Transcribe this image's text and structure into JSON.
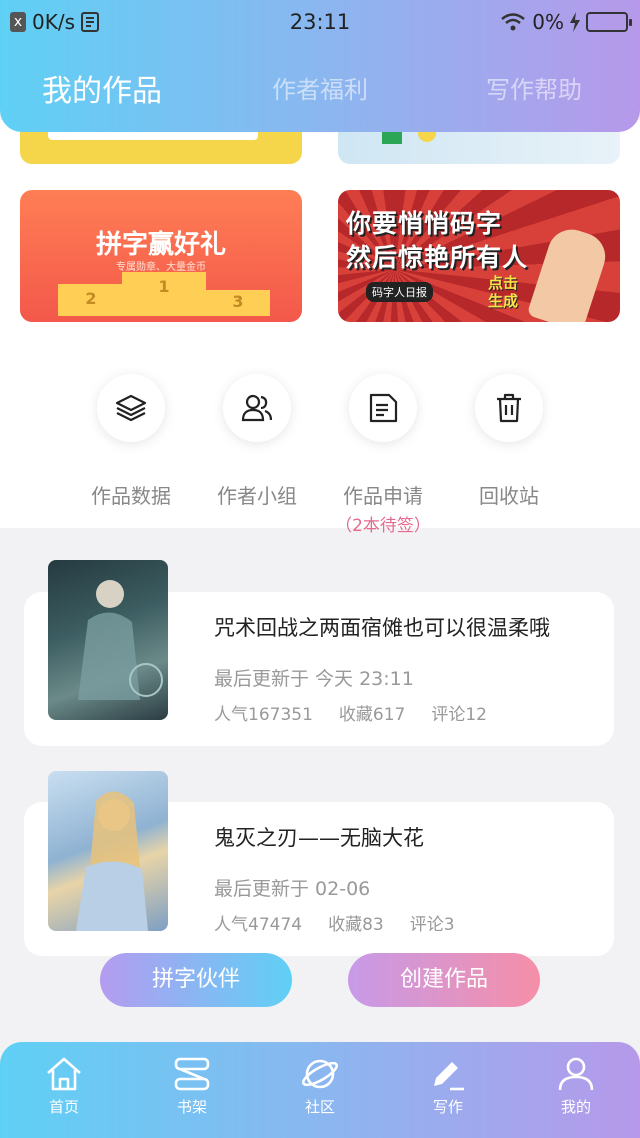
{
  "status_bar": {
    "speed": "0K/s",
    "time": "23:11",
    "battery": "0%"
  },
  "header": {
    "tabs": [
      {
        "label": "我的作品",
        "active": true
      },
      {
        "label": "作者福利",
        "active": false
      },
      {
        "label": "写作帮助",
        "active": false
      }
    ]
  },
  "banners": {
    "left_title": "拼字赢好礼",
    "left_sub": "专属勋章、大量金币",
    "podium": [
      "2",
      "1",
      "3"
    ],
    "right_line1": "你要悄悄码字",
    "right_line2": "然后惊艳所有人",
    "right_tag": "码字人日报",
    "right_cta1": "点击",
    "right_cta2": "生成"
  },
  "actions": [
    {
      "label": "作品数据",
      "icon": "layers-icon"
    },
    {
      "label": "作者小组",
      "icon": "group-icon"
    },
    {
      "label": "作品申请",
      "icon": "document-icon",
      "note": "（2本待签）"
    },
    {
      "label": "回收站",
      "icon": "trash-icon"
    }
  ],
  "works": [
    {
      "title": "咒术回战之两面宿傩也可以很温柔哦",
      "updated": "最后更新于 今天 23:11",
      "popularity": "人气167351",
      "favorites": "收藏617",
      "comments": "评论12"
    },
    {
      "title": "鬼灭之刃——无脑大花",
      "updated": "最后更新于 02-06",
      "popularity": "人气47474",
      "favorites": "收藏83",
      "comments": "评论3"
    }
  ],
  "buttons": {
    "partner": "拼字伙伴",
    "create": "创建作品"
  },
  "nav": [
    {
      "label": "首页",
      "icon": "home-icon"
    },
    {
      "label": "书架",
      "icon": "bookshelf-icon"
    },
    {
      "label": "社区",
      "icon": "planet-icon"
    },
    {
      "label": "写作",
      "icon": "pen-icon",
      "active": true
    },
    {
      "label": "我的",
      "icon": "user-icon"
    }
  ],
  "colors": {
    "gradient_start": "#5fd0f5",
    "gradient_end": "#b699ea",
    "pending": "#e46a8e"
  }
}
